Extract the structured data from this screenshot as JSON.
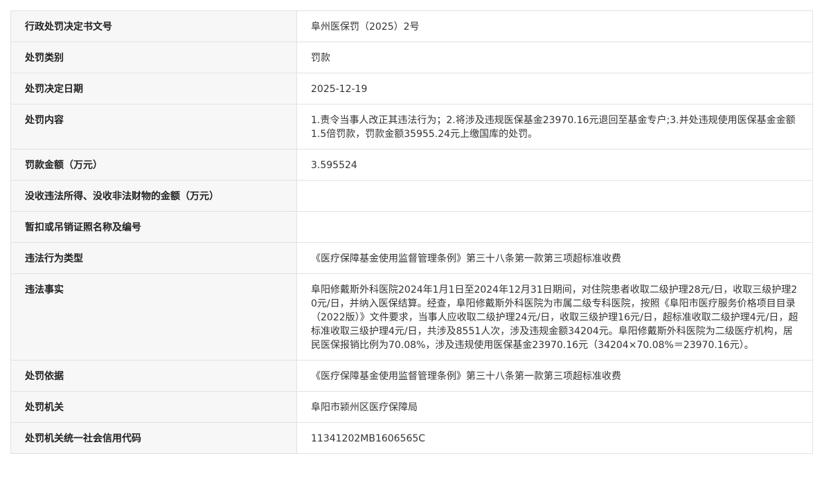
{
  "rows": [
    {
      "label": "行政处罚决定书文号",
      "value": "阜州医保罚（2025）2号"
    },
    {
      "label": "处罚类别",
      "value": "罚款"
    },
    {
      "label": "处罚决定日期",
      "value": "2025-12-19"
    },
    {
      "label": "处罚内容",
      "value": "1.责令当事人改正其违法行为；2.将涉及违规医保基金23970.16元退回至基金专户;3.并处违规使用医保基金金额1.5倍罚款，罚款金额35955.24元上缴国库的处罚。"
    },
    {
      "label": "罚款金额（万元）",
      "value": "3.595524"
    },
    {
      "label": "没收违法所得、没收非法财物的金额（万元）",
      "value": ""
    },
    {
      "label": "暂扣或吊销证照名称及编号",
      "value": ""
    },
    {
      "label": "违法行为类型",
      "value": "《医疗保障基金使用监督管理条例》第三十八条第一款第三项超标准收费"
    },
    {
      "label": "违法事实",
      "value": "阜阳修戴斯外科医院2024年1月1日至2024年12月31日期间，对住院患者收取二级护理28元/日，收取三级护理20元/日，并纳入医保结算。经查，阜阳修戴斯外科医院为市属二级专科医院，按照《阜阳市医疗服务价格项目目录（2022版）》文件要求，当事人应收取二级护理24元/日，收取三级护理16元/日，超标准收取二级护理4元/日，超标准收取三级护理4元/日，共涉及8551人次，涉及违规金额34204元。阜阳修戴斯外科医院为二级医疗机构，居民医保报销比例为70.08%，涉及违规使用医保基金23970.16元（34204×70.08%＝23970.16元）。"
    },
    {
      "label": "处罚依据",
      "value": "《医疗保障基金使用监督管理条例》第三十八条第一款第三项超标准收费"
    },
    {
      "label": "处罚机关",
      "value": "阜阳市颍州区医疗保障局"
    },
    {
      "label": "处罚机关统一社会信用代码",
      "value": "11341202MB1606565C"
    }
  ]
}
